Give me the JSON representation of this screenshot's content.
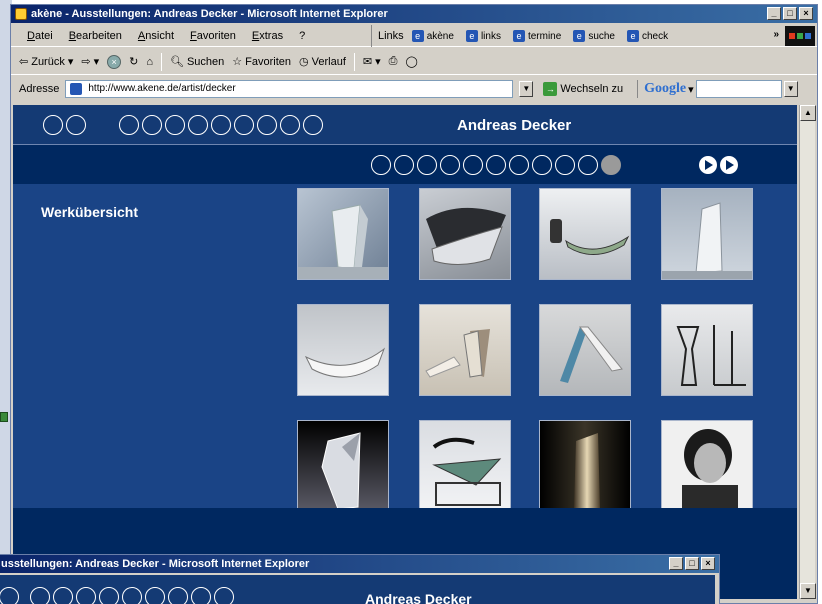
{
  "window": {
    "title": "akène - Ausstellungen: Andreas Decker - Microsoft Internet Explorer"
  },
  "menu": {
    "items": [
      "Datei",
      "Bearbeiten",
      "Ansicht",
      "Favoriten",
      "Extras",
      "?"
    ]
  },
  "links": {
    "label": "Links",
    "items": [
      "akène",
      "links",
      "termine",
      "suche",
      "check"
    ]
  },
  "toolbar": {
    "back": "Zurück",
    "search": "Suchen",
    "favorites": "Favoriten",
    "history": "Verlauf"
  },
  "address": {
    "label": "Adresse",
    "url": "http://www.akene.de/artist/decker",
    "go": "Wechseln zu",
    "google": "Google"
  },
  "page": {
    "artist_name": "Andreas Decker",
    "section_title": "Werkübersicht",
    "nav_active_index": 10
  },
  "thumbnails": [
    "folded-vase",
    "curved-bowl",
    "glass-dish",
    "tall-vase",
    "flat-bowl",
    "folded-objects",
    "arch-sculpture",
    "outline-vases",
    "folded-vessel",
    "square-bowl",
    "dark-vase",
    "artist-portrait"
  ],
  "window2": {
    "title": "usstellungen: Andreas Decker - Microsoft Internet Explorer",
    "artist_name": "Andreas Decker"
  }
}
